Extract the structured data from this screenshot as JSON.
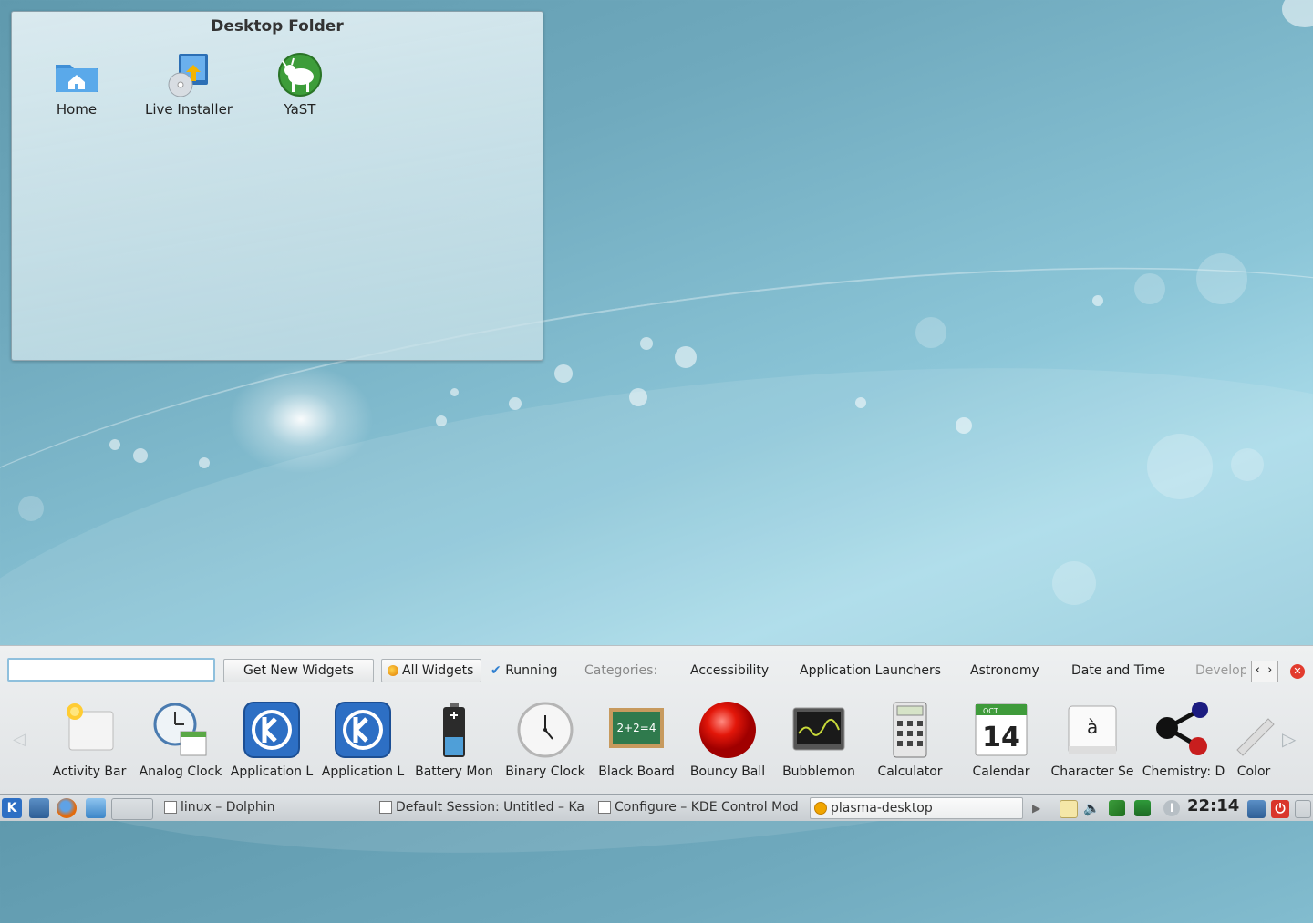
{
  "desktop": {
    "folder_title": "Desktop Folder",
    "icons": [
      {
        "label": "Home",
        "icon": "home-folder-icon"
      },
      {
        "label": "Live Installer",
        "icon": "installer-icon"
      },
      {
        "label": "YaST",
        "icon": "yast-icon"
      }
    ]
  },
  "explorer": {
    "search_value": "",
    "get_new_widgets": "Get New Widgets",
    "all_widgets": "All Widgets",
    "running": "Running",
    "categories_label": "Categories:",
    "categories": [
      "Accessibility",
      "Application Launchers",
      "Astronomy",
      "Date and Time",
      "Develop"
    ],
    "widgets": [
      {
        "label": "Activity Bar",
        "icon": "activity-bar-icon"
      },
      {
        "label": "Analog Clock",
        "icon": "analog-clock-icon"
      },
      {
        "label": "Application L",
        "icon": "kde-launcher-icon"
      },
      {
        "label": "Application L",
        "icon": "kde-launcher-icon"
      },
      {
        "label": "Battery Mon",
        "icon": "battery-icon"
      },
      {
        "label": "Binary Clock",
        "icon": "binary-clock-icon"
      },
      {
        "label": "Black Board",
        "icon": "blackboard-icon"
      },
      {
        "label": "Bouncy Ball",
        "icon": "bouncy-ball-icon"
      },
      {
        "label": "Bubblemon",
        "icon": "bubblemon-icon"
      },
      {
        "label": "Calculator",
        "icon": "calculator-icon"
      },
      {
        "label": "Calendar",
        "icon": "calendar-icon"
      },
      {
        "label": "Character Se",
        "icon": "character-selector-icon"
      },
      {
        "label": "Chemistry: D",
        "icon": "chemistry-icon"
      },
      {
        "label": "Color",
        "icon": "color-picker-icon"
      }
    ],
    "calendar_day": "14",
    "calendar_month": "OCT",
    "character_glyph": "à",
    "blackboard_text": "2+2=4"
  },
  "taskbar": {
    "tasks": [
      {
        "label": "linux – Dolphin"
      },
      {
        "label": "Default Session: Untitled – Ka"
      },
      {
        "label": "Configure – KDE Control Mod"
      },
      {
        "label": "plasma-desktop"
      }
    ],
    "clock": "22:14"
  },
  "colors": {
    "accent": "#2f7fd0",
    "close_red": "#e23b2e"
  }
}
